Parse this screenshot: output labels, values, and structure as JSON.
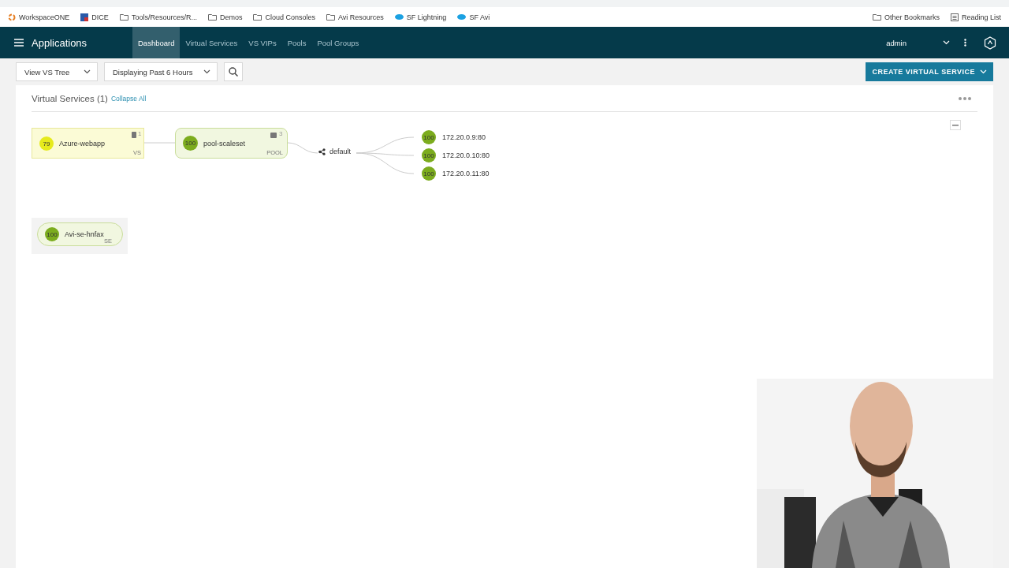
{
  "bookmarks": [
    {
      "label": "WorkspaceONE",
      "kind": "ring"
    },
    {
      "label": "DICE",
      "kind": "tile"
    },
    {
      "label": "Tools/Resources/R...",
      "kind": "folder"
    },
    {
      "label": "Demos",
      "kind": "folder"
    },
    {
      "label": "Cloud Consoles",
      "kind": "folder"
    },
    {
      "label": "Avi Resources",
      "kind": "folder"
    },
    {
      "label": "SF Lightning",
      "kind": "cloud"
    },
    {
      "label": "SF Avi",
      "kind": "cloud"
    }
  ],
  "bookmarks_right": [
    {
      "label": "Other Bookmarks",
      "kind": "folder"
    },
    {
      "label": "Reading List",
      "kind": "list"
    }
  ],
  "nav": {
    "title": "Applications",
    "tabs": [
      {
        "label": "Dashboard",
        "selected": true
      },
      {
        "label": "Virtual Services",
        "selected": false
      },
      {
        "label": "VS VIPs",
        "selected": false
      },
      {
        "label": "Pools",
        "selected": false
      },
      {
        "label": "Pool Groups",
        "selected": false
      }
    ],
    "user": "admin"
  },
  "toolbar": {
    "view": "View VS Tree",
    "time": "Displaying Past 6 Hours",
    "create": "CREATE VIRTUAL SERVICE"
  },
  "panel": {
    "title": "Virtual Services (1)",
    "collapse": "Collapse All"
  },
  "tree": {
    "vs": {
      "score": "79",
      "color": "#e6ea1c",
      "name": "Azure-webapp",
      "count": "1",
      "type": "VS"
    },
    "pool": {
      "score": "100",
      "color": "#7cac1e",
      "name": "pool-scaleset",
      "count": "3",
      "type": "POOL"
    },
    "group": "default",
    "servers": [
      {
        "score": "100",
        "color": "#7cac1e",
        "address": "172.20.0.9:80"
      },
      {
        "score": "100",
        "color": "#7cac1e",
        "address": "172.20.0.10:80"
      },
      {
        "score": "100",
        "color": "#7cac1e",
        "address": "172.20.0.11:80"
      }
    ],
    "se": {
      "score": "100",
      "color": "#7cac1e",
      "name": "Avi-se-hnfax",
      "type": "SE"
    }
  }
}
